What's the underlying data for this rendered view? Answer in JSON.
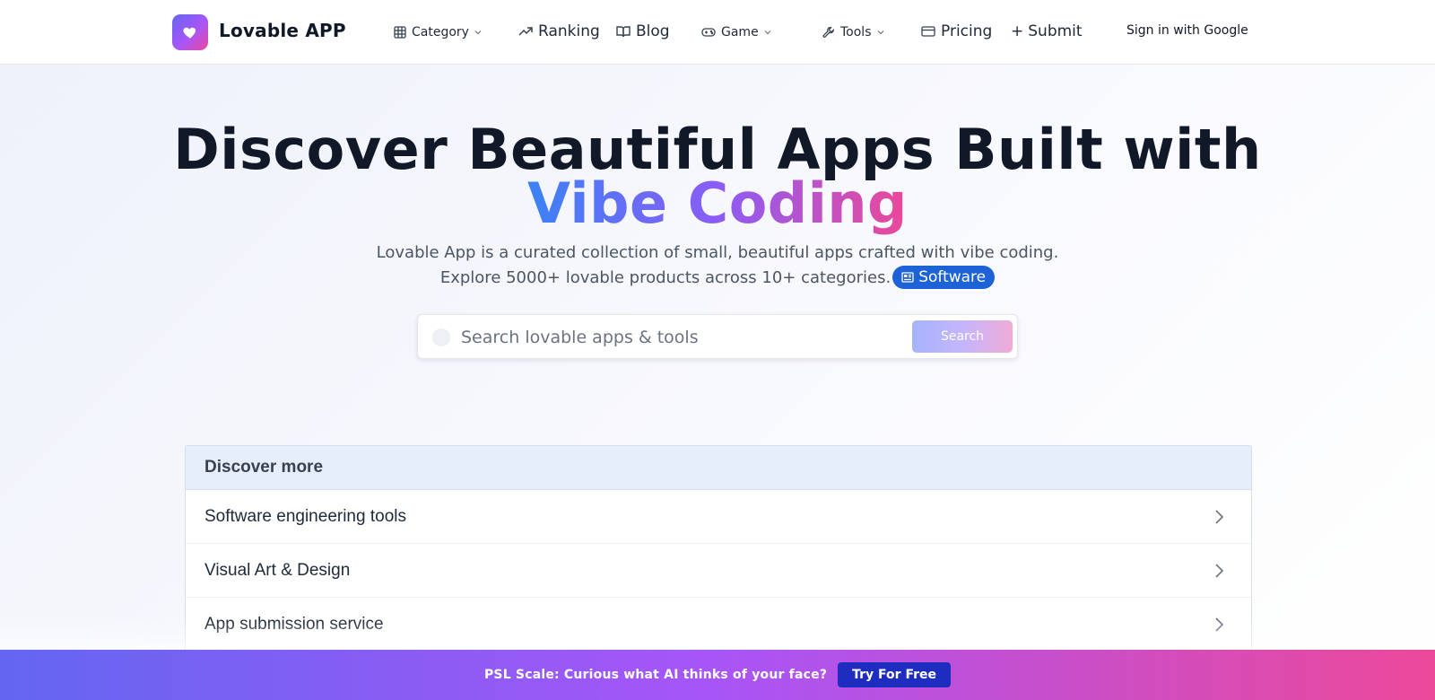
{
  "brand": {
    "name": "Lovable APP",
    "logo_icon": "heart-icon"
  },
  "nav": {
    "category": "Category",
    "ranking": "Ranking",
    "blog": "Blog",
    "game": "Game",
    "tools": "Tools",
    "pricing": "Pricing",
    "submit": "Submit",
    "submit_prefix": "+",
    "signin": "Sign in with Google"
  },
  "hero": {
    "title_line1": "Discover Beautiful Apps Built with",
    "title_highlight": "Vibe Coding",
    "subtitle_line1": "Lovable App is a curated collection of small, beautiful apps crafted with vibe coding.",
    "subtitle_line2": "Explore 5000+ lovable products across 10+ categories.",
    "badge": "Software"
  },
  "search": {
    "placeholder": "Search lovable apps & tools",
    "button": "Search"
  },
  "discover": {
    "heading": "Discover more",
    "items": [
      {
        "label": "Software engineering tools"
      },
      {
        "label": "Visual Art & Design"
      },
      {
        "label": "App submission service"
      }
    ]
  },
  "banner": {
    "text": "PSL Scale: Curious what AI thinks of your face?",
    "button": "Try For Free"
  },
  "colors": {
    "brand_gradient_start": "#6366f1",
    "brand_gradient_end": "#ec4899",
    "badge_blue": "#1d62d6",
    "banner_button": "#1e2dbf"
  }
}
